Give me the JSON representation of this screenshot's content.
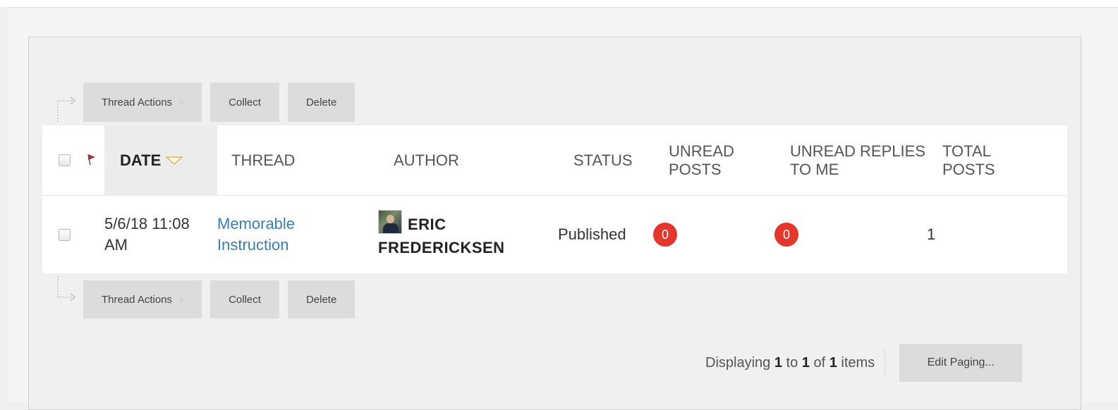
{
  "action_bar": {
    "thread_actions_label": "Thread Actions",
    "collect_label": "Collect",
    "delete_label": "Delete"
  },
  "table": {
    "headers": {
      "date": "DATE",
      "thread": "THREAD",
      "author": "AUTHOR",
      "status": "STATUS",
      "unread_posts": "UNREAD POSTS",
      "unread_replies": "UNREAD REPLIES TO ME",
      "total_posts": "TOTAL POSTS"
    },
    "rows": [
      {
        "date": "5/6/18 11:08 AM",
        "thread": "Memorable Instruction",
        "author": "ERIC FREDERICKSEN",
        "status": "Published",
        "unread_posts": "0",
        "unread_replies": "0",
        "total_posts": "1"
      }
    ]
  },
  "paging": {
    "prefix": "Displaying",
    "from": "1",
    "to_word": "to",
    "to": "1",
    "of_word": "of",
    "total": "1",
    "suffix": "items",
    "edit_label": "Edit Paging..."
  },
  "colors": {
    "badge": "#e5362b",
    "link": "#3a7db5",
    "button_bg": "#dcdcdc"
  }
}
